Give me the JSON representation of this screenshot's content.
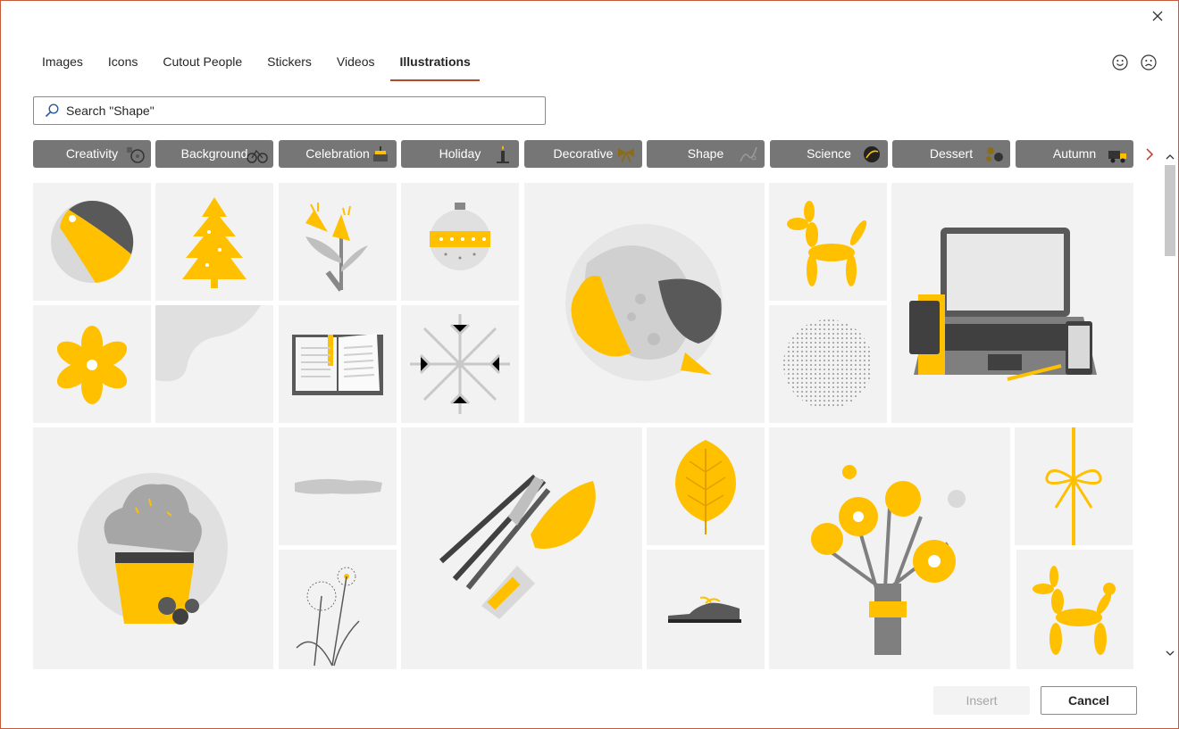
{
  "dialog": {
    "close_icon": "close-icon",
    "accent_color": "#b7472a"
  },
  "tabs": [
    {
      "label": "Images"
    },
    {
      "label": "Icons"
    },
    {
      "label": "Cutout People"
    },
    {
      "label": "Stickers"
    },
    {
      "label": "Videos"
    },
    {
      "label": "Illustrations",
      "active": true
    }
  ],
  "feedback": {
    "happy_icon": "smile-icon",
    "sad_icon": "frown-icon"
  },
  "search": {
    "value": "",
    "placeholder": "Search \"Shape\"",
    "icon": "search-icon"
  },
  "categories": [
    {
      "label": "Creativity"
    },
    {
      "label": "Background"
    },
    {
      "label": "Celebration"
    },
    {
      "label": "Holiday"
    },
    {
      "label": "Decorative"
    },
    {
      "label": "Shape"
    },
    {
      "label": "Science"
    },
    {
      "label": "Dessert"
    },
    {
      "label": "Autumn"
    }
  ],
  "categories_next_icon": "chevron-right-icon",
  "colors": {
    "yellow": "#ffc000",
    "dark_gray": "#595959",
    "mid_gray": "#a6a6a6",
    "light_gray": "#d9d9d9",
    "tile_bg": "#f2f2f2",
    "chip_bg": "#767676"
  },
  "tiles": [
    "beach-ball",
    "christmas-tree",
    "lily-flower",
    "christmas-ornament",
    "koi-fish-circle",
    "balloon-dog",
    "laptop-desk",
    "yellow-flower",
    "gray-blob-shape",
    "open-book",
    "snowflake",
    "dotted-circle",
    "cupcake",
    "gray-brush-stroke",
    "paint-brushes",
    "monstera-leaf",
    "flower-bouquet",
    "gift-ribbon",
    "dandelions",
    "shoe",
    "balloon-dog-small"
  ],
  "buttons": {
    "insert": "Insert",
    "cancel": "Cancel"
  }
}
